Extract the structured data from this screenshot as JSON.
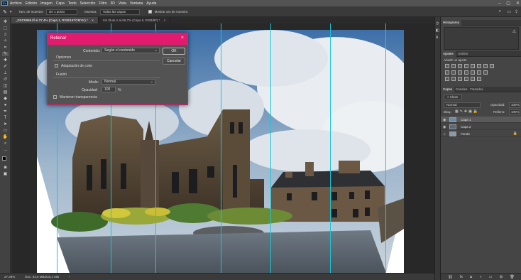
{
  "menu": [
    "Archivo",
    "Edición",
    "Imagen",
    "Capa",
    "Texto",
    "Selección",
    "Filtro",
    "3D",
    "Vista",
    "Ventana",
    "Ayuda"
  ],
  "app_logo": "Ps",
  "options_bar": {
    "sample_size_label": "Tam. de muestra:",
    "sample_size_value": "De 1 punto",
    "sample_label": "Muestra:",
    "sample_value": "Todas las capas",
    "show_ring_label": "Mostrar aro de muestra"
  },
  "tabs": [
    {
      "label": "_DSC5969.tif al 27,4% (Capa 1, RGB/16*/CMYK) *",
      "close": "×"
    },
    {
      "label": "Sin título-1 al 66,7% (Capa 5, RGB/8#) *",
      "close": "×"
    }
  ],
  "status": {
    "zoom": "27,39%",
    "doc": "Doc: 93,8 MB/233,4 MB"
  },
  "dialog": {
    "title": "Rellenar",
    "close": "×",
    "contents_label": "Contenido:",
    "contents_value": "Según el contenido",
    "options_heading": "Opciones",
    "color_adapt_label": "Adaptación de color",
    "blend_heading": "Fusión",
    "mode_label": "Modo:",
    "mode_value": "Normal",
    "opacity_label": "Opacidad:",
    "opacity_value": "100",
    "opacity_unit": "%",
    "preserve_label": "Mantener transparencia",
    "ok_label": "OK",
    "cancel_label": "Cancelar"
  },
  "panels": {
    "histogram_tab": "Histograma",
    "adjustments_tabs": [
      "Ajustes",
      "Estilos"
    ],
    "adjustments_hint": "Añadir un ajuste",
    "layers_tabs": [
      "Capas",
      "Canales",
      "Trazados"
    ],
    "kind_label": "Clase",
    "blend_value": "Normal",
    "opacity_label": "Opacidad:",
    "opacity_value": "100%",
    "lock_label": "Bloq.:",
    "fill_label": "Relleno:",
    "fill_value": "100%",
    "layers": [
      {
        "name": "Capa 1",
        "selected": true
      },
      {
        "name": "Capa 2",
        "selected": false
      },
      {
        "name": "Fondo",
        "selected": false
      }
    ]
  },
  "colors": {
    "accent": "#e21b6f",
    "guide": "#17c7d8",
    "ui_dark": "#3c3c3c"
  }
}
